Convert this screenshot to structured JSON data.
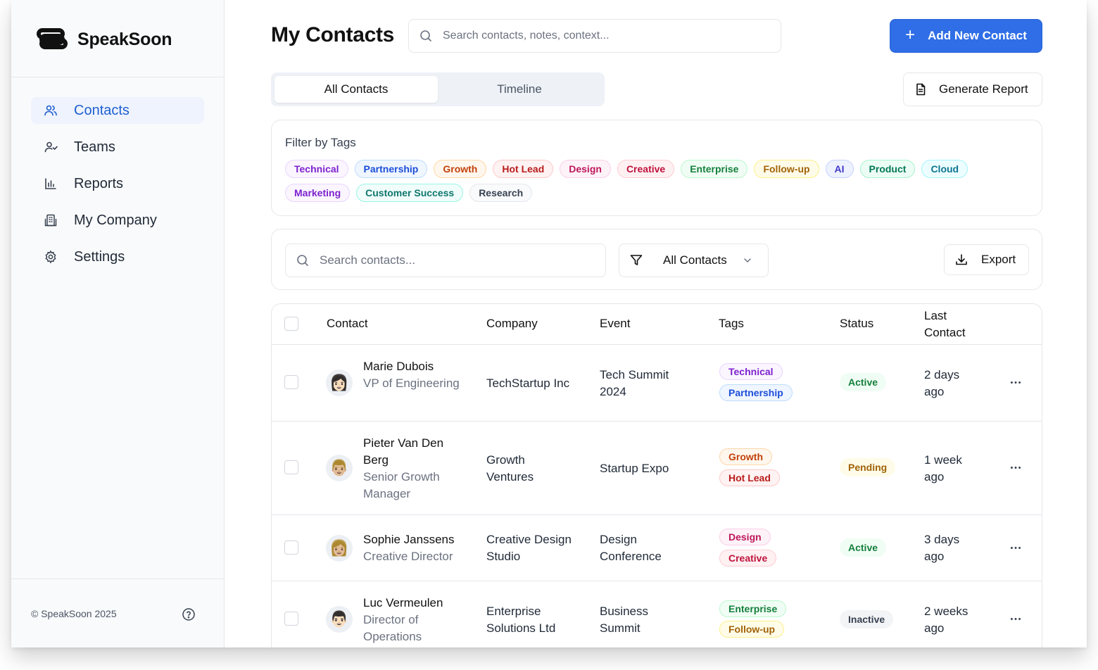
{
  "brand": {
    "name": "SpeakSoon"
  },
  "sidebar": {
    "items": [
      {
        "label": "Contacts",
        "icon": "users-icon",
        "active": true
      },
      {
        "label": "Teams",
        "icon": "user-check-icon",
        "active": false
      },
      {
        "label": "Reports",
        "icon": "bar-chart-icon",
        "active": false
      },
      {
        "label": "My Company",
        "icon": "building-icon",
        "active": false
      },
      {
        "label": "Settings",
        "icon": "gear-icon",
        "active": false
      }
    ],
    "footer": {
      "copyright": "© SpeakSoon 2025",
      "help_icon": "help-circle-icon"
    }
  },
  "header": {
    "title": "My Contacts",
    "search_placeholder": "Search contacts, notes, context...",
    "add_button": "Add New Contact"
  },
  "tabs": [
    {
      "label": "All Contacts",
      "active": true
    },
    {
      "label": "Timeline",
      "active": false
    }
  ],
  "generate_report": "Generate Report",
  "filter": {
    "title": "Filter by Tags",
    "tags": [
      {
        "label": "Technical",
        "fg": "#7e22ce",
        "bg": "#faf5ff",
        "border": "#e9d5ff"
      },
      {
        "label": "Partnership",
        "fg": "#1d4ed8",
        "bg": "#eff6ff",
        "border": "#bfdbfe"
      },
      {
        "label": "Growth",
        "fg": "#c2410c",
        "bg": "#fff7ed",
        "border": "#fed7aa"
      },
      {
        "label": "Hot Lead",
        "fg": "#b91c1c",
        "bg": "#fef2f2",
        "border": "#fecaca"
      },
      {
        "label": "Design",
        "fg": "#be185d",
        "bg": "#fdf2f8",
        "border": "#fbcfe8"
      },
      {
        "label": "Creative",
        "fg": "#be123c",
        "bg": "#fff1f2",
        "border": "#fecdd3"
      },
      {
        "label": "Enterprise",
        "fg": "#15803d",
        "bg": "#f0fdf4",
        "border": "#bbf7d0"
      },
      {
        "label": "Follow-up",
        "fg": "#a16207",
        "bg": "#fefce8",
        "border": "#fef08a"
      },
      {
        "label": "AI",
        "fg": "#4338ca",
        "bg": "#eef2ff",
        "border": "#c7d2fe"
      },
      {
        "label": "Product",
        "fg": "#047857",
        "bg": "#ecfdf5",
        "border": "#a7f3d0"
      },
      {
        "label": "Cloud",
        "fg": "#0e7490",
        "bg": "#ecfeff",
        "border": "#a5f3fc"
      },
      {
        "label": "Marketing",
        "fg": "#7e22ce",
        "bg": "#faf5ff",
        "border": "#e9d5ff"
      },
      {
        "label": "Customer Success",
        "fg": "#0f766e",
        "bg": "#f0fdfa",
        "border": "#99f6e4"
      },
      {
        "label": "Research",
        "fg": "#374151",
        "bg": "#f9fafb",
        "border": "#e5e7eb"
      }
    ]
  },
  "toolbar": {
    "search_placeholder": "Search contacts...",
    "filter_value": "All Contacts",
    "export_label": "Export"
  },
  "table": {
    "columns": [
      "Contact",
      "Company",
      "Event",
      "Tags",
      "Status",
      "Last Contact"
    ],
    "rows": [
      {
        "name": "Marie Dubois",
        "title": "VP of Engineering",
        "avatar": "👩🏻",
        "company": "TechStartup Inc",
        "event": "Tech Summit 2024",
        "tags": [
          "Technical",
          "Partnership"
        ],
        "status": "Active",
        "last_contact": "2 days ago"
      },
      {
        "name": "Pieter Van Den Berg",
        "title": "Senior Growth Manager",
        "avatar": "👨🏼",
        "company": "Growth Ventures",
        "event": "Startup Expo",
        "tags": [
          "Growth",
          "Hot Lead"
        ],
        "status": "Pending",
        "last_contact": "1 week ago"
      },
      {
        "name": "Sophie Janssens",
        "title": "Creative Director",
        "avatar": "👩🏼",
        "company": "Creative Design Studio",
        "event": "Design Conference",
        "tags": [
          "Design",
          "Creative"
        ],
        "status": "Active",
        "last_contact": "3 days ago"
      },
      {
        "name": "Luc Vermeulen",
        "title": "Director of Operations",
        "avatar": "👨🏻",
        "company": "Enterprise Solutions Ltd",
        "event": "Business Summit",
        "tags": [
          "Enterprise",
          "Follow-up"
        ],
        "status": "Inactive",
        "last_contact": "2 weeks ago"
      }
    ]
  },
  "status_colors": {
    "Active": {
      "fg": "#15803d",
      "bg": "#f0fdf4"
    },
    "Pending": {
      "fg": "#a16207",
      "bg": "#fefce8"
    },
    "Inactive": {
      "fg": "#374151",
      "bg": "#f3f4f6"
    }
  },
  "colors": {
    "accent": "#2f6ee6",
    "active_nav_bg": "#eef3fd",
    "active_nav_fg": "#1f5fd1"
  }
}
